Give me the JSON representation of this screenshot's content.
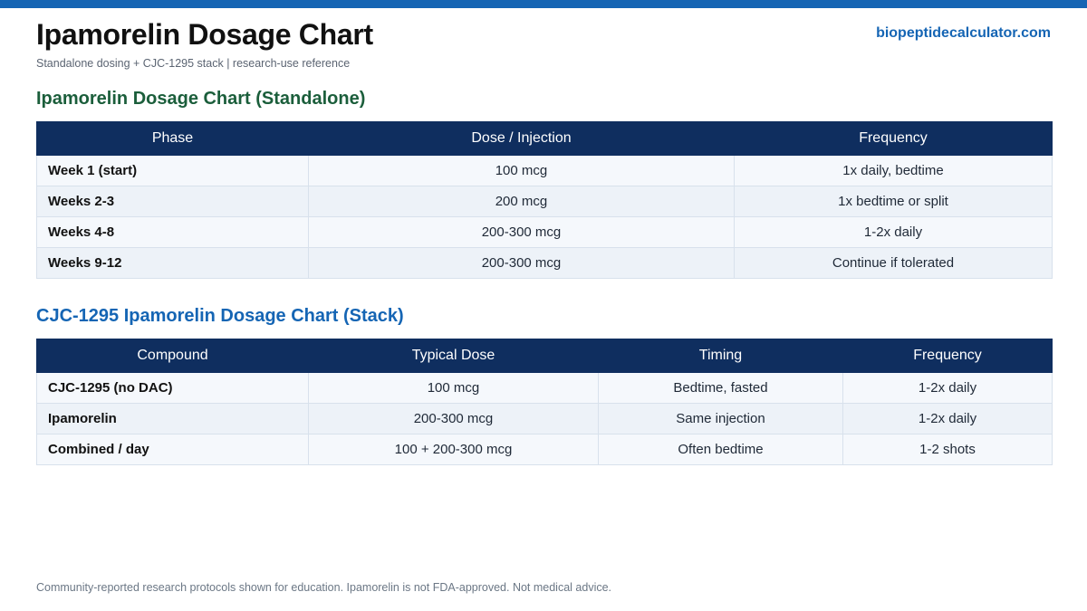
{
  "header": {
    "title": "Ipamorelin Dosage Chart",
    "subtitle": "Standalone dosing + CJC-1295 stack  |  research-use reference",
    "site": "biopeptidecalculator.com"
  },
  "standalone": {
    "title": "Ipamorelin Dosage Chart (Standalone)",
    "columns": [
      "Phase",
      "Dose / Injection",
      "Frequency"
    ],
    "rows": [
      [
        "Week 1 (start)",
        "100 mcg",
        "1x daily, bedtime"
      ],
      [
        "Weeks 2-3",
        "200 mcg",
        "1x bedtime or split"
      ],
      [
        "Weeks 4-8",
        "200-300 mcg",
        "1-2x daily"
      ],
      [
        "Weeks 9-12",
        "200-300 mcg",
        "Continue if tolerated"
      ]
    ]
  },
  "stack": {
    "title": "CJC-1295 Ipamorelin Dosage Chart (Stack)",
    "columns": [
      "Compound",
      "Typical Dose",
      "Timing",
      "Frequency"
    ],
    "rows": [
      [
        "CJC-1295 (no DAC)",
        "100 mcg",
        "Bedtime, fasted",
        "1-2x daily"
      ],
      [
        "Ipamorelin",
        "200-300 mcg",
        "Same injection",
        "1-2x daily"
      ],
      [
        "Combined / day",
        "100 + 200-300 mcg",
        "Often bedtime",
        "1-2 shots"
      ]
    ]
  },
  "footer": {
    "note": "Community-reported research protocols shown for education. Ipamorelin is not FDA-approved. Not medical advice."
  },
  "colors": {
    "accent_bar": "#1565b4",
    "header_row": "#0f2e5f",
    "section_green": "#1b5e3b",
    "section_blue": "#1565b4"
  }
}
